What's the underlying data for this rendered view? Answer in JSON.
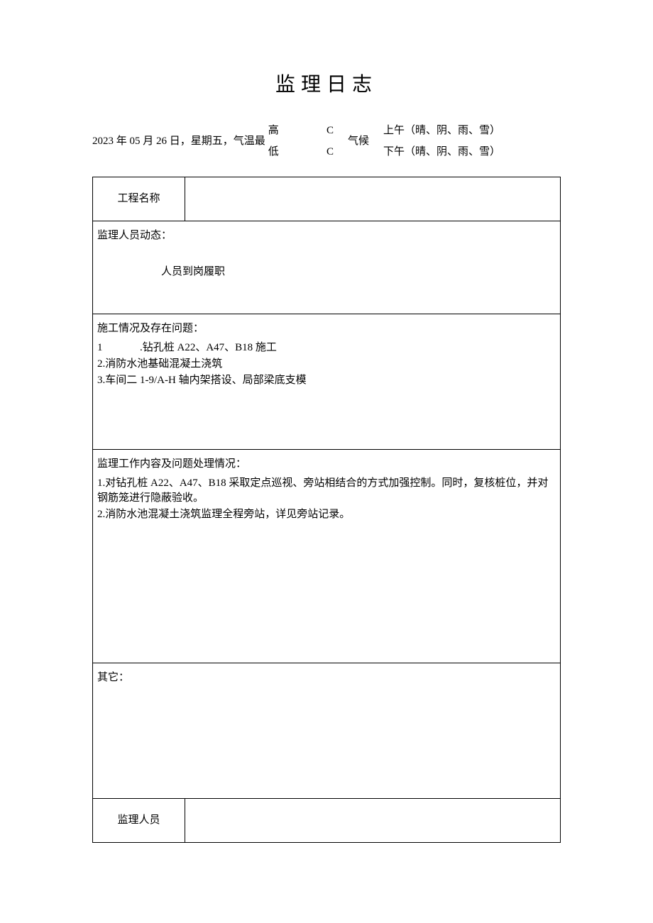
{
  "title": "监理日志",
  "meta": {
    "date_prefix": "2023 年 05 月 26 日，星期五，气温最",
    "high": "高",
    "low": "低",
    "c_label": "C",
    "climate_label": "气候",
    "morning": "上午（晴、阴、雨、雪）",
    "afternoon": "下午（晴、阴、雨、雪）"
  },
  "rows": {
    "project_name_label": "工程名称",
    "project_name_value": "",
    "personnel": {
      "title": "监理人员动态：",
      "duty": "人员到岗履职"
    },
    "construction": {
      "title": "施工情况及存在问题：",
      "item1_num": "1",
      "item1_text": ".钻孔桩 A22、A47、B18 施工",
      "item2": "2.消防水池基础混凝土浇筑",
      "item3": "3.车间二 1-9/A-H 轴内架搭设、局部梁底支模"
    },
    "supervision": {
      "title": "监理工作内容及问题处理情况：",
      "item1": "1.对钻孔桩 A22、A47、B18 采取定点巡视、旁站相结合的方式加强控制。同时，复核桩位，并对钢筋笼进行隐蔽验收。",
      "item2": "2.消防水池混凝土浇筑监理全程旁站，详见旁站记录。"
    },
    "other": {
      "title": "其它："
    },
    "supervisor_label": "监理人员",
    "supervisor_value": ""
  }
}
